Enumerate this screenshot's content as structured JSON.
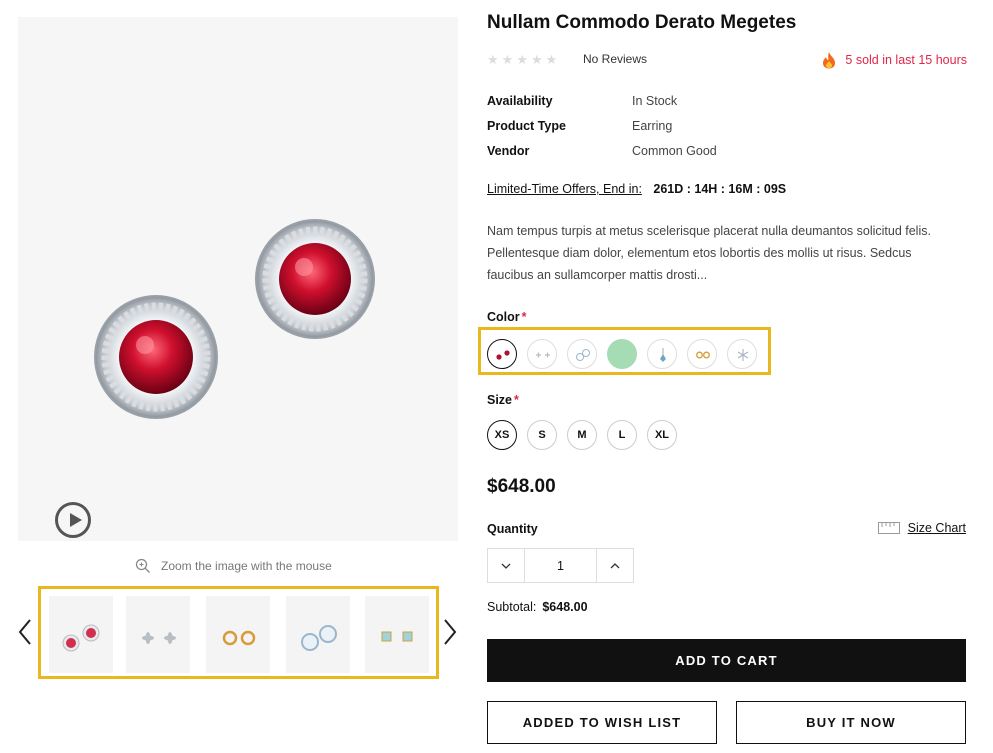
{
  "product": {
    "title": "Nullam Commodo Derato Megetes",
    "reviews_text": "No Reviews",
    "rating_stars": 0,
    "sold_text": "5 sold in last 15 hours"
  },
  "meta": [
    {
      "key": "Availability",
      "value": "In Stock"
    },
    {
      "key": "Product Type",
      "value": "Earring"
    },
    {
      "key": "Vendor",
      "value": "Common Good"
    }
  ],
  "countdown": {
    "label": "Limited-Time Offers, End in:",
    "value": "261D : 14H : 16M : 09S"
  },
  "description": "Nam tempus turpis at metus scelerisque placerat nulla deumantos solicitud felis. Pellentesque diam dolor, elementum etos lobortis des mollis ut risus. Sedcus faucibus an sullamcorper mattis drosti...",
  "color": {
    "label": "Color",
    "required": "*",
    "selected_index": 0,
    "swatches": [
      "ruby-studs",
      "silver-flower-studs",
      "blue-round-studs",
      "mint-green",
      "blue-drop-earring",
      "gold-studs",
      "silver-star-earring"
    ]
  },
  "size": {
    "label": "Size",
    "required": "*",
    "options": [
      "XS",
      "S",
      "M",
      "L",
      "XL"
    ],
    "selected": "XS"
  },
  "price": "$648.00",
  "quantity": {
    "label": "Quantity",
    "value": "1"
  },
  "size_chart": "Size Chart",
  "subtotal": {
    "label": "Subtotal:",
    "value": "$648.00"
  },
  "buttons": {
    "add_to_cart": "ADD TO CART",
    "wish_list": "ADDED TO WISH LIST",
    "buy_now": "BUY IT NOW"
  },
  "gallery": {
    "zoom_hint": "Zoom the image with the mouse",
    "thumbnails": [
      "ruby-studs",
      "silver-flower-studs",
      "gold-studs",
      "blue-round-studs",
      "aquamarine-square-studs"
    ]
  },
  "colors": {
    "accent_red": "#e0264a",
    "highlight_yellow": "#e8b81e",
    "button_black": "#111111"
  }
}
